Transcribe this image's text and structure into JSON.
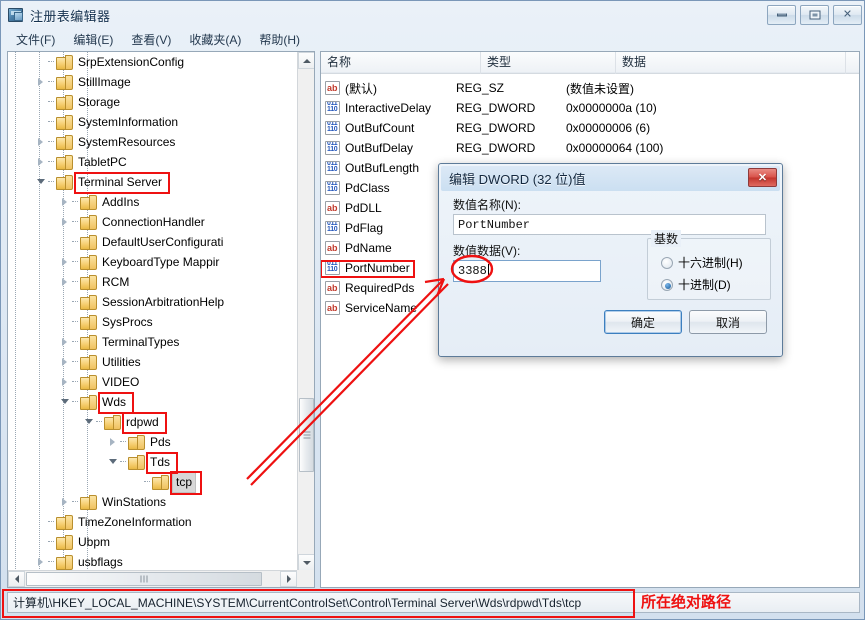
{
  "window": {
    "title": "注册表编辑器",
    "icon": "registry-editor-icon",
    "buttons": {
      "minimize": "minimize-icon",
      "maximize": "restore-icon",
      "close": "✕"
    }
  },
  "menubar": {
    "items": [
      {
        "label": "文件(F)"
      },
      {
        "label": "编辑(E)"
      },
      {
        "label": "查看(V)"
      },
      {
        "label": "收藏夹(A)"
      },
      {
        "label": "帮助(H)"
      }
    ]
  },
  "tree": {
    "nodes": [
      {
        "label": "SrpExtensionConfig",
        "indent": 2,
        "state": "leaf"
      },
      {
        "label": "StillImage",
        "indent": 2,
        "state": "collapsed"
      },
      {
        "label": "Storage",
        "indent": 2,
        "state": "leaf"
      },
      {
        "label": "SystemInformation",
        "indent": 2,
        "state": "leaf"
      },
      {
        "label": "SystemResources",
        "indent": 2,
        "state": "collapsed"
      },
      {
        "label": "TabletPC",
        "indent": 2,
        "state": "collapsed"
      },
      {
        "label": "Terminal Server",
        "indent": 2,
        "state": "expanded",
        "annotated": true
      },
      {
        "label": "AddIns",
        "indent": 3,
        "state": "collapsed"
      },
      {
        "label": "ConnectionHandler",
        "indent": 3,
        "state": "collapsed"
      },
      {
        "label": "DefaultUserConfigurati",
        "indent": 3,
        "state": "leaf"
      },
      {
        "label": "KeyboardType Mappir",
        "indent": 3,
        "state": "collapsed"
      },
      {
        "label": "RCM",
        "indent": 3,
        "state": "collapsed"
      },
      {
        "label": "SessionArbitrationHelp",
        "indent": 3,
        "state": "leaf"
      },
      {
        "label": "SysProcs",
        "indent": 3,
        "state": "leaf"
      },
      {
        "label": "TerminalTypes",
        "indent": 3,
        "state": "collapsed"
      },
      {
        "label": "Utilities",
        "indent": 3,
        "state": "collapsed"
      },
      {
        "label": "VIDEO",
        "indent": 3,
        "state": "collapsed"
      },
      {
        "label": "Wds",
        "indent": 3,
        "state": "expanded",
        "annotated": true
      },
      {
        "label": "rdpwd",
        "indent": 4,
        "state": "expanded",
        "annotated": true
      },
      {
        "label": "Pds",
        "indent": 5,
        "state": "collapsed"
      },
      {
        "label": "Tds",
        "indent": 5,
        "state": "expanded",
        "annotated": true
      },
      {
        "label": "tcp",
        "indent": 6,
        "state": "leaf",
        "selected": true,
        "annotated": true
      },
      {
        "label": "WinStations",
        "indent": 3,
        "state": "collapsed"
      },
      {
        "label": "TimeZoneInformation",
        "indent": 2,
        "state": "leaf"
      },
      {
        "label": "Ubpm",
        "indent": 2,
        "state": "leaf"
      },
      {
        "label": "usbflags",
        "indent": 2,
        "state": "collapsed"
      }
    ]
  },
  "values": {
    "columns": [
      "名称",
      "类型",
      "数据"
    ],
    "rows": [
      {
        "icon": "string-value-icon",
        "kind": "sz",
        "name": "(默认)",
        "type": "REG_SZ",
        "data": "(数值未设置)"
      },
      {
        "icon": "dword-value-icon",
        "kind": "dw",
        "name": "InteractiveDelay",
        "type": "REG_DWORD",
        "data": "0x0000000a (10)"
      },
      {
        "icon": "dword-value-icon",
        "kind": "dw",
        "name": "OutBufCount",
        "type": "REG_DWORD",
        "data": "0x00000006 (6)"
      },
      {
        "icon": "dword-value-icon",
        "kind": "dw",
        "name": "OutBufDelay",
        "type": "REG_DWORD",
        "data": "0x00000064 (100)"
      },
      {
        "icon": "dword-value-icon",
        "kind": "dw",
        "name": "OutBufLength",
        "type": "",
        "data": ""
      },
      {
        "icon": "dword-value-icon",
        "kind": "dw",
        "name": "PdClass",
        "type": "",
        "data": ""
      },
      {
        "icon": "string-value-icon",
        "kind": "sz",
        "name": "PdDLL",
        "type": "",
        "data": ""
      },
      {
        "icon": "dword-value-icon",
        "kind": "dw",
        "name": "PdFlag",
        "type": "",
        "data": ""
      },
      {
        "icon": "string-value-icon",
        "kind": "sz",
        "name": "PdName",
        "type": "",
        "data": ""
      },
      {
        "icon": "dword-value-icon",
        "kind": "dw",
        "name": "PortNumber",
        "type": "",
        "data": "",
        "annotated": true
      },
      {
        "icon": "string-value-icon",
        "kind": "sz",
        "name": "RequiredPds",
        "type": "",
        "data": ""
      },
      {
        "icon": "string-value-icon",
        "kind": "sz",
        "name": "ServiceName",
        "type": "",
        "data": ""
      }
    ]
  },
  "dialog": {
    "title": "编辑 DWORD (32 位)值",
    "close_label": "✕",
    "name_label": "数值名称(N):",
    "name_value": "PortNumber",
    "data_label": "数值数据(V):",
    "data_value": "3388",
    "radix_legend": "基数",
    "radix_options": [
      {
        "label": "十六进制(H)",
        "selected": false
      },
      {
        "label": "十进制(D)",
        "selected": true
      }
    ],
    "ok_label": "确定",
    "cancel_label": "取消"
  },
  "statusbar": {
    "path": "计算机\\HKEY_LOCAL_MACHINE\\SYSTEM\\CurrentControlSet\\Control\\Terminal Server\\Wds\\rdpwd\\Tds\\tcp"
  },
  "annotations": {
    "path_note": "所在绝对路径",
    "color": "#ee1111"
  }
}
